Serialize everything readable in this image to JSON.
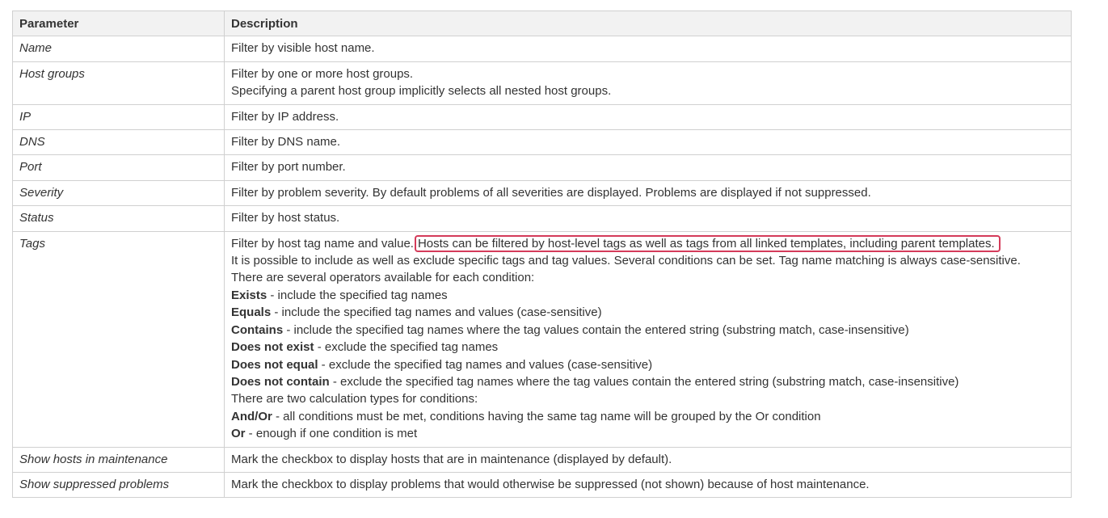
{
  "table": {
    "headers": {
      "parameter": "Parameter",
      "description": "Description"
    },
    "rows": {
      "name": {
        "param": "Name",
        "desc": "Filter by visible host name."
      },
      "host_groups": {
        "param": "Host groups",
        "desc1": "Filter by one or more host groups.",
        "desc2": "Specifying a parent host group implicitly selects all nested host groups."
      },
      "ip": {
        "param": "IP",
        "desc": "Filter by IP address."
      },
      "dns": {
        "param": "DNS",
        "desc": "Filter by DNS name."
      },
      "port": {
        "param": "Port",
        "desc": "Filter by port number."
      },
      "severity": {
        "param": "Severity",
        "desc": "Filter by problem severity. By default problems of all severities are displayed. Problems are displayed if not suppressed."
      },
      "status": {
        "param": "Status",
        "desc": "Filter by host status."
      },
      "tags": {
        "param": "Tags",
        "intro": "Filter by host tag name and value.",
        "highlighted": "Hosts can be filtered by host-level tags as well as tags from all linked templates, including parent templates.",
        "line2": "It is possible to include as well as exclude specific tags and tag values. Several conditions can be set. Tag name matching is always case-sensitive.",
        "line3": "There are several operators available for each condition:",
        "operators": [
          {
            "term": "Exists",
            "text": " - include the specified tag names"
          },
          {
            "term": "Equals",
            "text": " - include the specified tag names and values (case-sensitive)"
          },
          {
            "term": "Contains",
            "text": " - include the specified tag names where the tag values contain the entered string (substring match, case-insensitive)"
          },
          {
            "term": "Does not exist",
            "text": " - exclude the specified tag names"
          },
          {
            "term": "Does not equal",
            "text": " - exclude the specified tag names and values (case-sensitive)"
          },
          {
            "term": "Does not contain",
            "text": " - exclude the specified tag names where the tag values contain the entered string (substring match, case-insensitive)"
          }
        ],
        "calc_intro": "There are two calculation types for conditions:",
        "calc_types": [
          {
            "term": "And/Or",
            "text": " - all conditions must be met, conditions having the same tag name will be grouped by the Or condition"
          },
          {
            "term": "Or",
            "text": " - enough if one condition is met"
          }
        ]
      },
      "maintenance": {
        "param": "Show hosts in maintenance",
        "desc": "Mark the checkbox to display hosts that are in maintenance (displayed by default)."
      },
      "suppressed": {
        "param": "Show suppressed problems",
        "desc": "Mark the checkbox to display problems that would otherwise be suppressed (not shown) because of host maintenance."
      }
    }
  },
  "colors": {
    "highlight_border": "#d43b5a",
    "header_bg": "#f2f2f2",
    "grid": "#d0d0d0"
  }
}
